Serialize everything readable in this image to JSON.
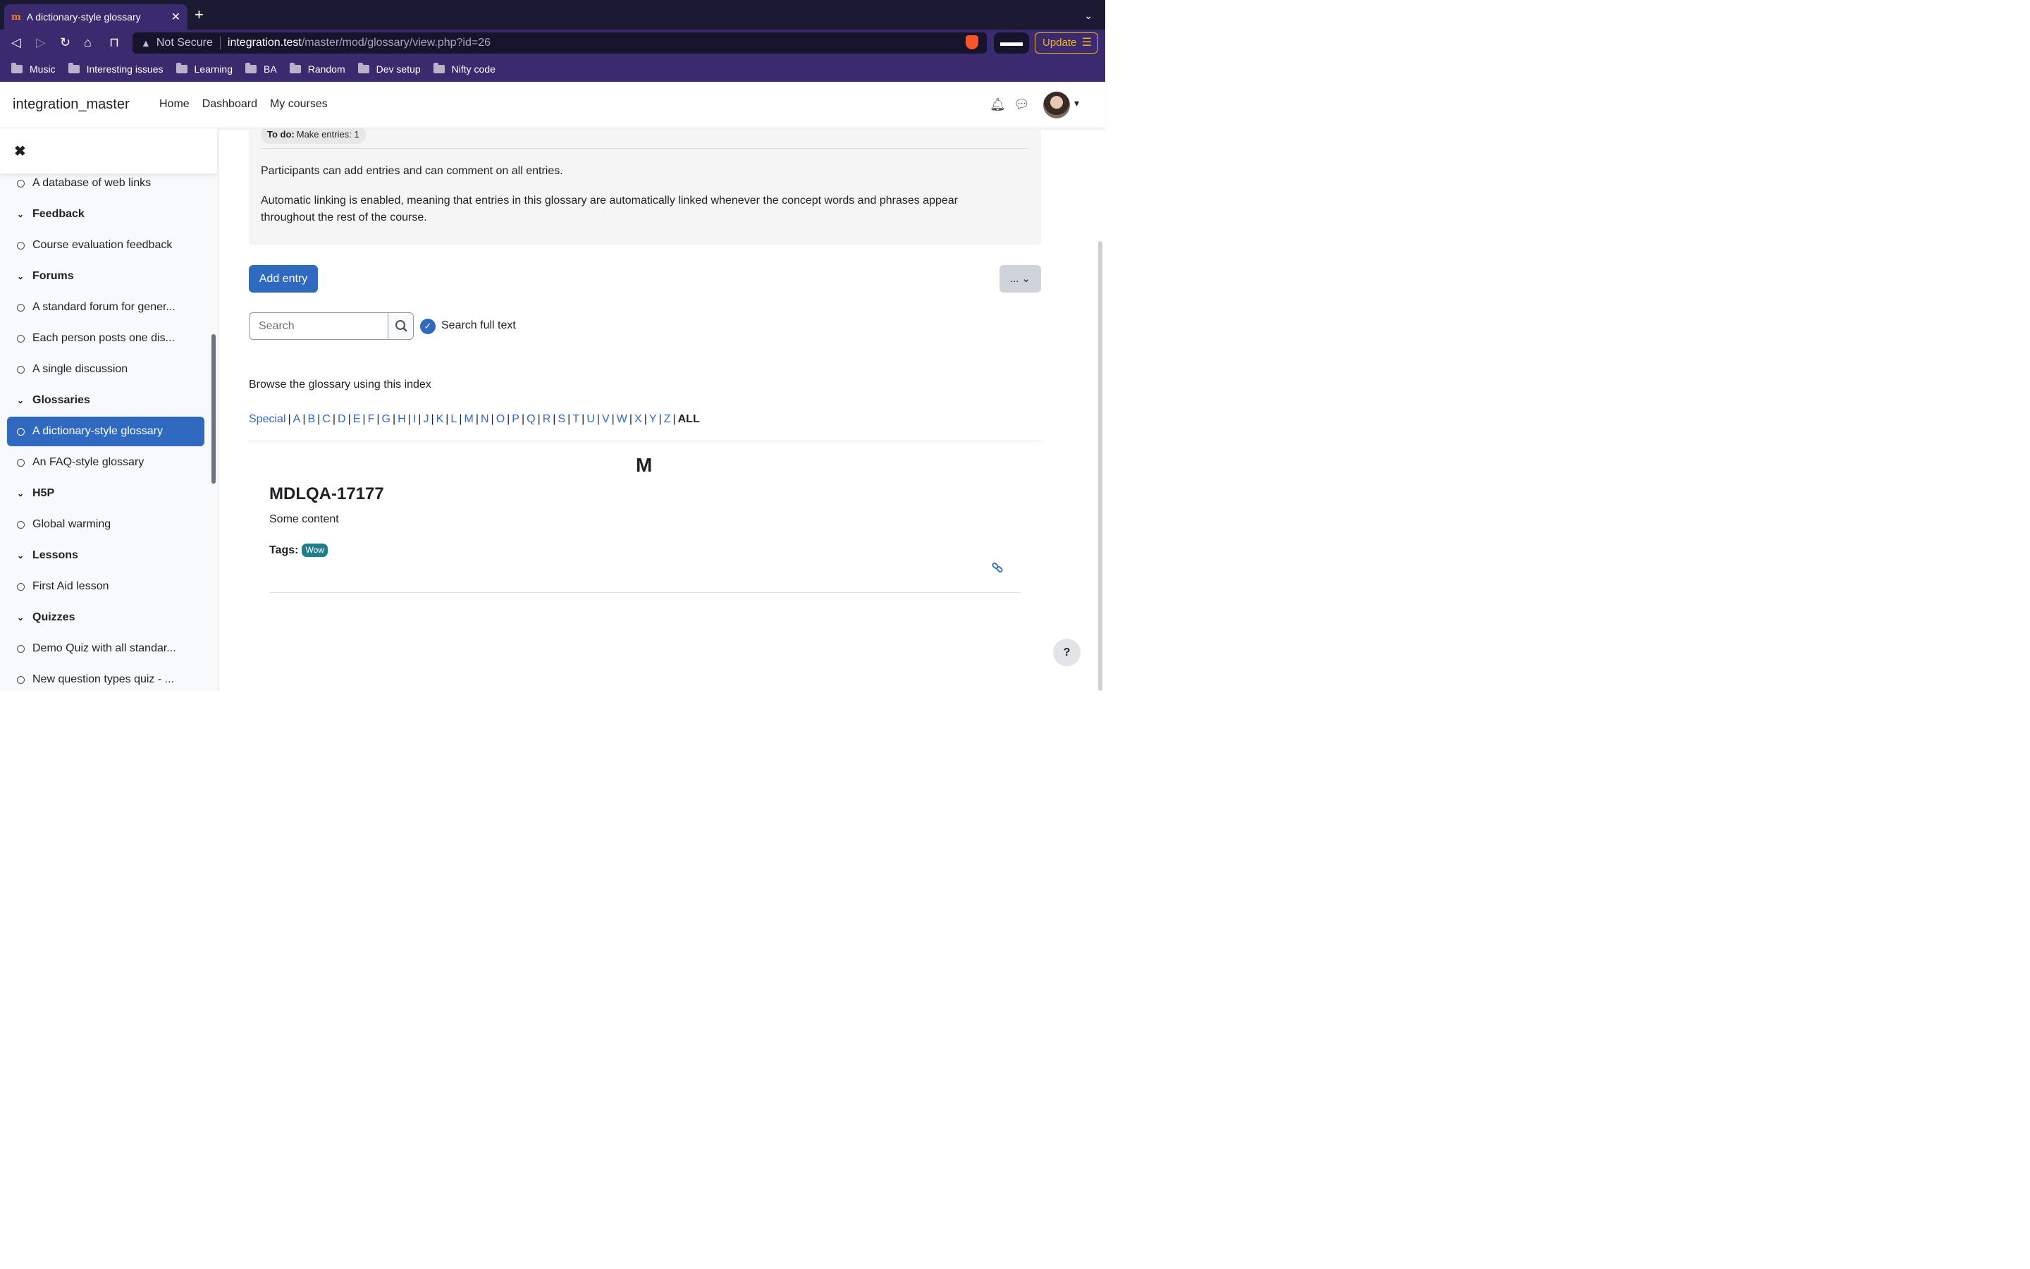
{
  "browser": {
    "tab_title": "A dictionary-style glossary",
    "favicon": "m",
    "url_warning": "Not Secure",
    "url_host": "integration.test",
    "url_path": "/master/mod/glossary/view.php?id=26",
    "update_label": "Update",
    "bookmarks": [
      "Music",
      "Interesting issues",
      "Learning",
      "BA",
      "Random",
      "Dev setup",
      "Nifty code"
    ]
  },
  "header": {
    "site_name": "integration_master",
    "nav": [
      "Home",
      "Dashboard",
      "My courses"
    ]
  },
  "drawer": {
    "items": [
      {
        "type": "activity",
        "label": "A database of web links"
      },
      {
        "type": "section",
        "label": "Feedback"
      },
      {
        "type": "activity",
        "label": "Course evaluation feedback"
      },
      {
        "type": "section",
        "label": "Forums"
      },
      {
        "type": "activity",
        "label": "A standard forum for gener..."
      },
      {
        "type": "activity",
        "label": "Each person posts one dis..."
      },
      {
        "type": "activity",
        "label": "A single discussion"
      },
      {
        "type": "section",
        "label": "Glossaries"
      },
      {
        "type": "activity",
        "label": "A dictionary-style glossary",
        "active": true
      },
      {
        "type": "activity",
        "label": "An FAQ-style glossary"
      },
      {
        "type": "section",
        "label": "H5P"
      },
      {
        "type": "activity",
        "label": "Global warming"
      },
      {
        "type": "section",
        "label": "Lessons"
      },
      {
        "type": "activity",
        "label": "First Aid lesson"
      },
      {
        "type": "section",
        "label": "Quizzes"
      },
      {
        "type": "activity",
        "label": "Demo Quiz with all standar..."
      },
      {
        "type": "activity",
        "label": "New question types quiz - ..."
      }
    ]
  },
  "main": {
    "todo_label": "To do:",
    "todo_text": "Make entries: 1",
    "info_p1": "Participants can add entries and can comment on all entries.",
    "info_p2": "Automatic linking is enabled, meaning that entries in this glossary are automatically linked whenever the concept words and phrases appear throughout the rest of the course.",
    "add_entry": "Add entry",
    "more_label": "...",
    "search_placeholder": "Search",
    "search_full_text": "Search full text",
    "browse_label": "Browse the glossary using this index",
    "alphabet": [
      "Special",
      "A",
      "B",
      "C",
      "D",
      "E",
      "F",
      "G",
      "H",
      "I",
      "J",
      "K",
      "L",
      "M",
      "N",
      "O",
      "P",
      "Q",
      "R",
      "S",
      "T",
      "U",
      "V",
      "W",
      "X",
      "Y",
      "Z"
    ],
    "all_label": "ALL",
    "letter_heading": "M",
    "entry": {
      "concept": "MDLQA-17177",
      "content": "Some content",
      "tags_label": "Tags:",
      "tags": [
        "Wow"
      ]
    },
    "help_label": "?"
  }
}
